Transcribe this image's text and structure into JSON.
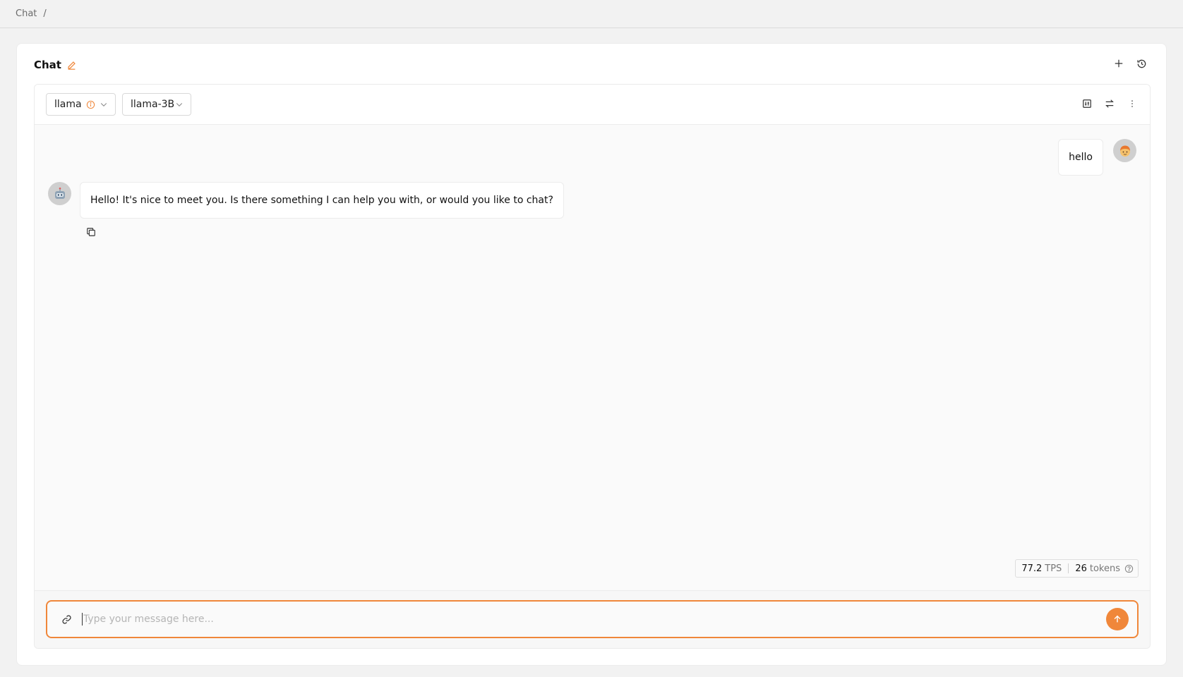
{
  "breadcrumb": {
    "root": "Chat",
    "separator": "/"
  },
  "card": {
    "title": "Chat",
    "title_icon": "edit-pencil-icon",
    "actions": [
      {
        "name": "new-chat-button",
        "icon": "plus-icon"
      },
      {
        "name": "history-button",
        "icon": "history-icon"
      }
    ]
  },
  "toolbar": {
    "provider": {
      "value": "llama",
      "icon": "info-circle-icon"
    },
    "model": {
      "value": "llama-3B"
    },
    "right_icons": [
      "layout-settings-icon",
      "swap-arrows-icon",
      "more-vertical-icon"
    ]
  },
  "messages": {
    "user": {
      "text": "hello",
      "avatar": "user-avatar-icon"
    },
    "assistant": {
      "text": "Hello! It's nice to meet you. Is there something I can help you with, or would you like to chat?",
      "avatar": "robot-avatar-icon"
    }
  },
  "stats": {
    "tps_value": "77.2",
    "tps_unit": "TPS",
    "tokens_value": "26",
    "tokens_unit": "tokens"
  },
  "composer": {
    "placeholder": "Type your message here...",
    "value": ""
  },
  "colors": {
    "accent": "#f0873a",
    "background": "#f2f2f2",
    "card": "#ffffff"
  }
}
